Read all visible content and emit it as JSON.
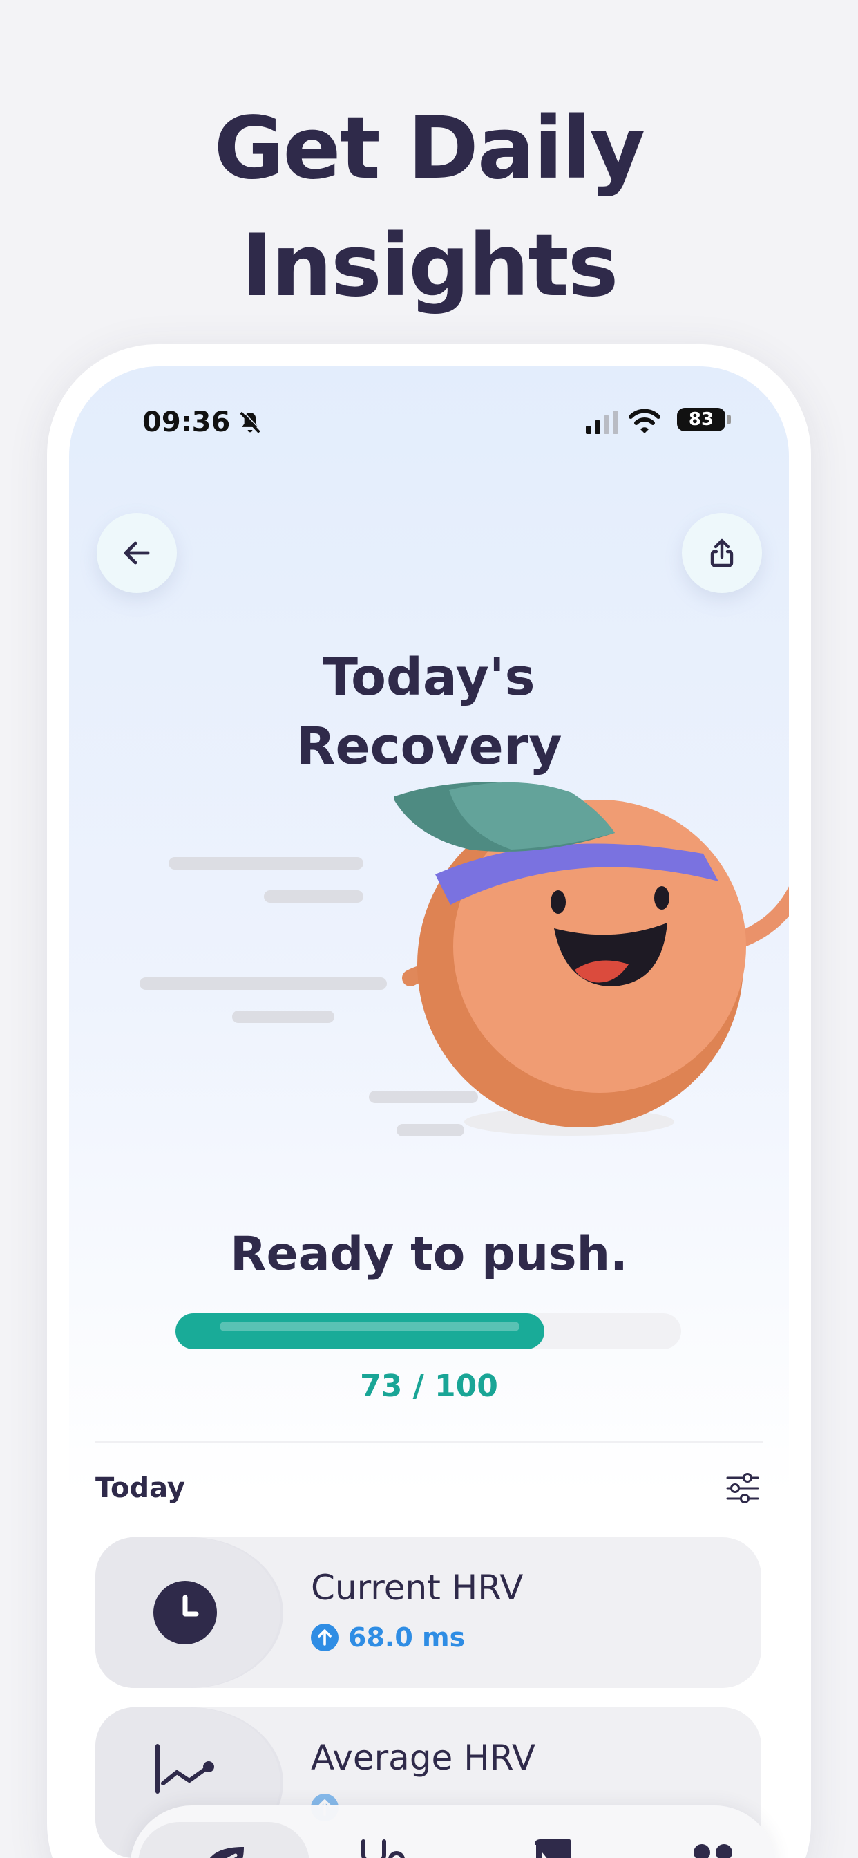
{
  "headline": {
    "line1": "Get Daily",
    "line2": "Insights"
  },
  "status_bar": {
    "time": "09:36",
    "battery": "83"
  },
  "screen": {
    "title_line1": "Today's",
    "title_line2": "Recovery",
    "status_text": "Ready to push.",
    "score": {
      "value": 73,
      "max": 100,
      "label": "73 / 100"
    }
  },
  "section": {
    "label": "Today"
  },
  "cards": [
    {
      "title": "Current HRV",
      "value": "68.0 ms",
      "trend": "up",
      "icon": "clock-icon"
    },
    {
      "title": "Average HRV",
      "value": "",
      "trend": "up",
      "icon": "trend-chart-icon"
    }
  ],
  "tabbar": {
    "tabs": [
      {
        "icon": "leaf-icon",
        "active": true
      },
      {
        "icon": "stethoscope-icon",
        "active": false
      },
      {
        "icon": "book-icon",
        "active": false
      },
      {
        "icon": "people-icon",
        "active": false
      }
    ]
  },
  "colors": {
    "accent": "#19ab98",
    "text": "#2f2a4a",
    "trend_up": "#2f8de4",
    "mascot_body": "#f09c73"
  }
}
